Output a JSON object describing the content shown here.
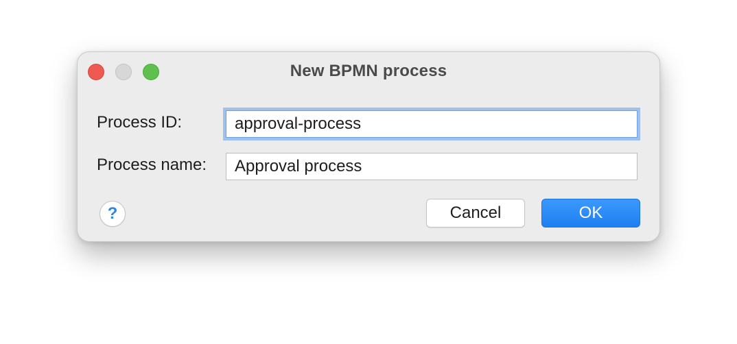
{
  "window": {
    "title": "New BPMN process"
  },
  "form": {
    "process_id": {
      "label": "Process ID:",
      "value": "approval-process"
    },
    "process_name": {
      "label": "Process name:",
      "value": "Approval process"
    }
  },
  "buttons": {
    "help_glyph": "?",
    "cancel_label": "Cancel",
    "ok_label": "OK"
  },
  "colors": {
    "accent": "#1e7ff2",
    "focus_ring": "#9fc1f0",
    "close": "#ee5a52",
    "zoom": "#5fbf4f"
  },
  "icons": {
    "close": "close-icon",
    "minimize": "minimize-icon",
    "zoom": "zoom-icon",
    "help": "help-icon"
  }
}
